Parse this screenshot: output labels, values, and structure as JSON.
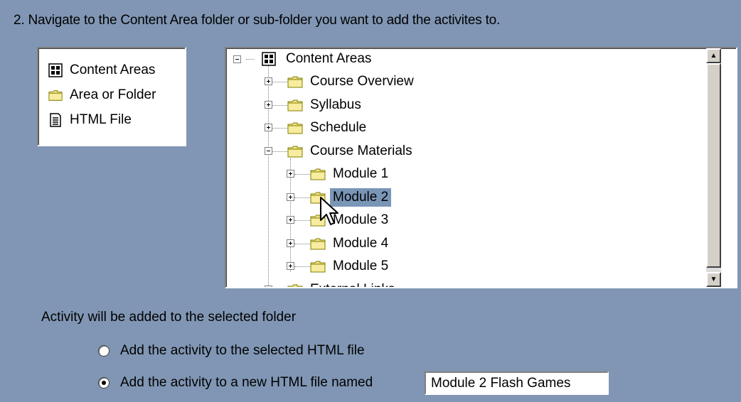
{
  "instruction": "2.  Navigate to the Content Area folder or sub-folder you want to add the activites to.",
  "legend": {
    "items": [
      {
        "icon": "content-areas-icon",
        "label": "Content Areas"
      },
      {
        "icon": "folder-icon",
        "label": "Area or Folder"
      },
      {
        "icon": "html-file-icon",
        "label": "HTML File"
      }
    ]
  },
  "tree": {
    "root": "Content Areas",
    "nodes": [
      {
        "label": "Course Overview",
        "expander": "plus"
      },
      {
        "label": "Syllabus",
        "expander": "plus"
      },
      {
        "label": "Schedule",
        "expander": "plus"
      },
      {
        "label": "Course Materials",
        "expander": "minus"
      },
      {
        "label": "Module 1",
        "expander": "plus"
      },
      {
        "label": "Module 2",
        "expander": "plus",
        "selected": true
      },
      {
        "label": "Module 3",
        "expander": "plus"
      },
      {
        "label": "Module 4",
        "expander": "plus"
      },
      {
        "label": "Module 5",
        "expander": "plus"
      },
      {
        "label": "External Links",
        "expander": "plus"
      }
    ]
  },
  "status_text": "Activity will be added to the selected folder",
  "options": [
    {
      "label": "Add the activity to the selected HTML file",
      "checked": false
    },
    {
      "label": "Add the activity to a new HTML file named",
      "checked": true
    }
  ],
  "new_file_name": "Module 2 Flash Games",
  "colors": {
    "background": "#8096b4",
    "selection": "#7a96b7",
    "folder": "#f2e188"
  }
}
